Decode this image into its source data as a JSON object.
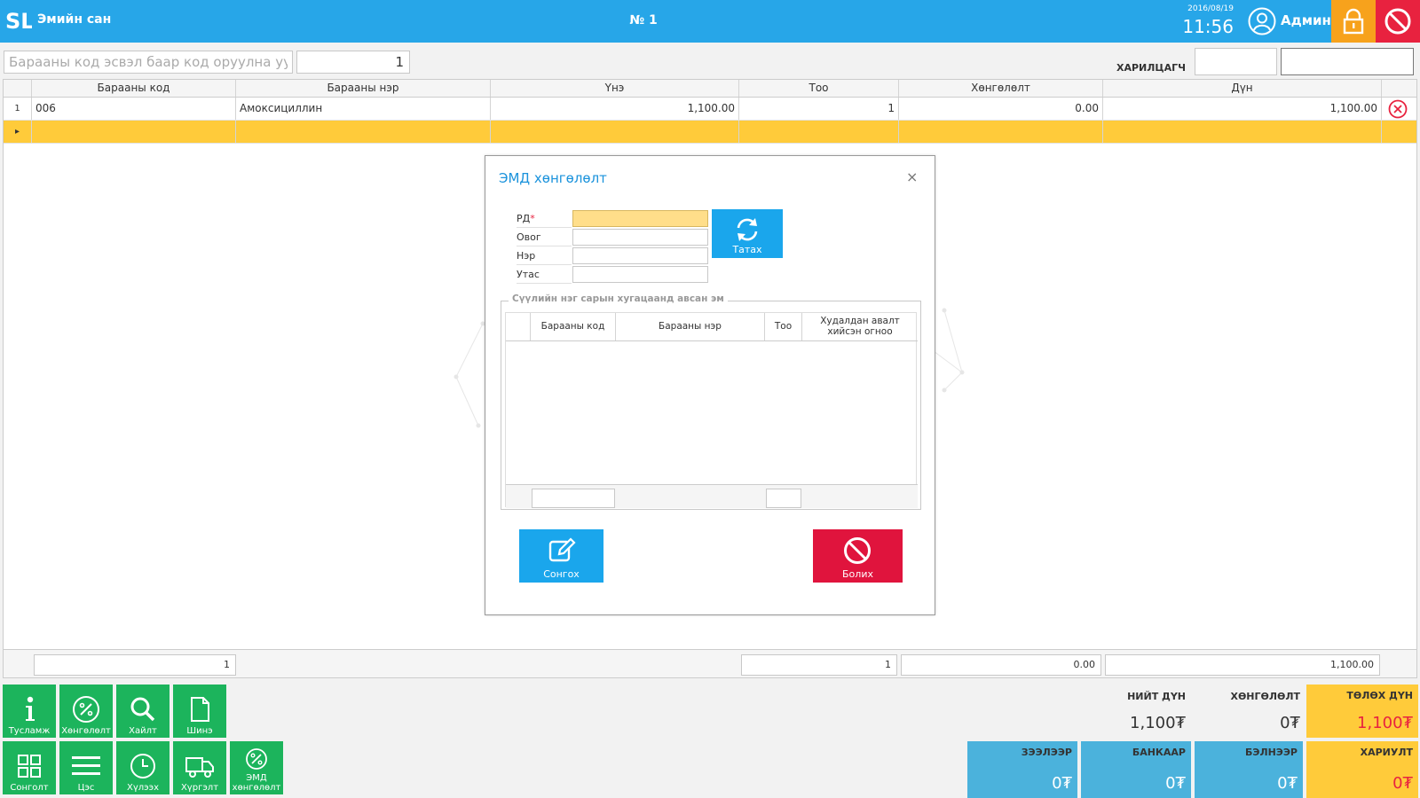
{
  "header": {
    "app_name": "Эмийн сан",
    "order_number": "№ 1",
    "date": "2016/08/19",
    "time": "11:56",
    "user_name": "Админ"
  },
  "search": {
    "placeholder": "Барааны код эсвэл баар код оруулна уу",
    "quantity": "1"
  },
  "customer": {
    "label": "ХАРИЛЦАГЧ"
  },
  "grid": {
    "columns": [
      "Барааны код",
      "Барааны нэр",
      "Үнэ",
      "Тоо",
      "Хөнгөлөлт",
      "Дүн"
    ],
    "rows": [
      {
        "index": "1",
        "code": "006",
        "name": "Амоксициллин",
        "price": "1,100.00",
        "qty": "1",
        "discount": "0.00",
        "amount": "1,100.00"
      }
    ],
    "new_row_marker": "▸",
    "totals": {
      "count": "1",
      "qty": "1",
      "discount": "0.00",
      "amount": "1,100.00"
    }
  },
  "dialog": {
    "title": "ЭМД хөнгөлөлт",
    "close": "×",
    "fields": {
      "rd": "РД",
      "rd_required": "*",
      "lastname": "Овог",
      "firstname": "Нэр",
      "phone": "Утас"
    },
    "fetch_button": "Татах",
    "group_title": "Сүүлийн нэг сарын хугацаанд авсан эм",
    "subgrid_columns": [
      "Барааны код",
      "Барааны нэр",
      "Тоо",
      "Худалдан авалт хийсэн огноо"
    ],
    "choose_button": "Сонгох",
    "cancel_button": "Болих"
  },
  "tiles": [
    {
      "label": "Тусламж",
      "icon": "info-icon"
    },
    {
      "label": "Хөнгөлөлт",
      "icon": "percent-icon"
    },
    {
      "label": "Хайлт",
      "icon": "search-icon"
    },
    {
      "label": "Шинэ",
      "icon": "new-document-icon"
    },
    {
      "label": "Сонголт",
      "icon": "grid-icon"
    },
    {
      "label": "Цэс",
      "icon": "menu-icon"
    },
    {
      "label": "Хүлээх",
      "icon": "clock-icon"
    },
    {
      "label": "Хүргэлт",
      "icon": "truck-icon"
    },
    {
      "label": "ЭМД хөнгөлөлт",
      "icon": "percent-icon"
    }
  ],
  "totals": {
    "total_label": "НИЙТ ДҮН",
    "total_value": "1,100₮",
    "discount_label": "ХӨНГӨЛӨЛТ",
    "discount_value": "0₮",
    "due_label": "ТӨЛӨХ ДҮН",
    "due_value": "1,100₮"
  },
  "payments": {
    "credit_label": "ЗЭЭЛЭЭР",
    "credit_value": "0₮",
    "bank_label": "БАНКААР",
    "bank_value": "0₮",
    "cash_label": "БЭЛНЭЭР",
    "cash_value": "0₮",
    "change_label": "ХАРИУЛТ",
    "change_value": "0₮"
  },
  "colors": {
    "header": "#27a6e8",
    "accent_yellow": "#ffcb3a",
    "tile_green": "#1cb45c",
    "danger_red": "#e8223f",
    "lock_orange": "#f7a21c",
    "pay_blue": "#4bb2dc"
  }
}
